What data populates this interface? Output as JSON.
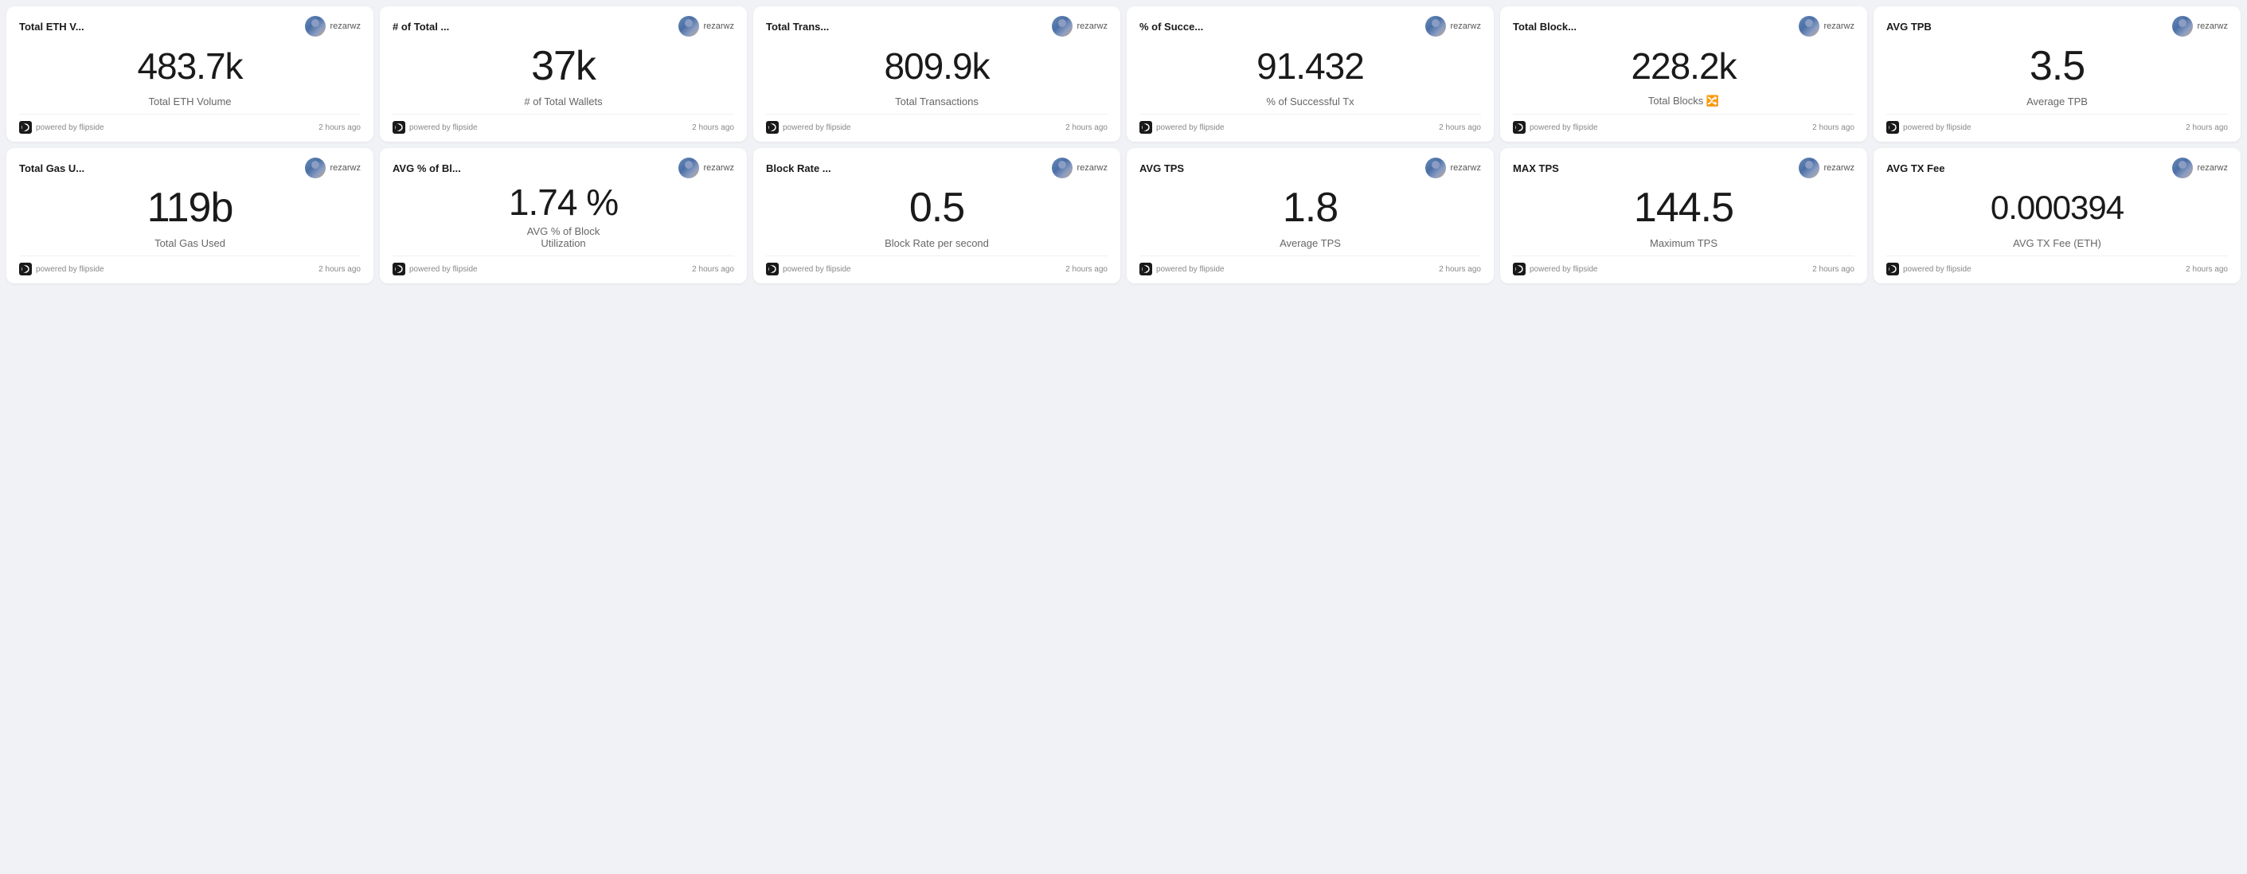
{
  "colors": {
    "accent": "#1a1a1a",
    "bg": "#f0f2f5",
    "card": "#ffffff"
  },
  "cards": [
    {
      "id": "card-1",
      "title": "Total ETH V...",
      "author": "rezarwz",
      "value": "483.7k",
      "label": "Total ETH Volume",
      "powered_by": "powered by flipside",
      "time_ago": "2 hours ago"
    },
    {
      "id": "card-2",
      "title": "# of Total ...",
      "author": "rezarwz",
      "value": "37k",
      "label": "# of Total Wallets",
      "powered_by": "powered by flipside",
      "time_ago": "2 hours ago"
    },
    {
      "id": "card-3",
      "title": "Total Trans...",
      "author": "rezarwz",
      "value": "809.9k",
      "label": "Total Transactions",
      "powered_by": "powered by flipside",
      "time_ago": "2 hours ago"
    },
    {
      "id": "card-4",
      "title": "% of Succe...",
      "author": "rezarwz",
      "value": "91.432",
      "label": "% of Successful Tx",
      "powered_by": "powered by flipside",
      "time_ago": "2 hours ago"
    },
    {
      "id": "card-5",
      "title": "Total Block...",
      "author": "rezarwz",
      "value": "228.2k",
      "label": "Total Blocks 🔀",
      "powered_by": "powered by flipside",
      "time_ago": "2 hours ago"
    },
    {
      "id": "card-6",
      "title": "AVG TPB",
      "author": "rezarwz",
      "value": "3.5",
      "label": "Average TPB",
      "powered_by": "powered by flipside",
      "time_ago": "2 hours ago"
    },
    {
      "id": "card-7",
      "title": "Total Gas U...",
      "author": "rezarwz",
      "value": "119b",
      "label": "Total Gas Used",
      "powered_by": "powered by flipside",
      "time_ago": "2 hours ago"
    },
    {
      "id": "card-8",
      "title": "AVG % of Bl...",
      "author": "rezarwz",
      "value": "1.74 %",
      "label": "AVG % of Block\nUtilization",
      "powered_by": "powered by flipside",
      "time_ago": "2 hours ago"
    },
    {
      "id": "card-9",
      "title": "Block Rate ...",
      "author": "rezarwz",
      "value": "0.5",
      "label": "Block Rate per second",
      "powered_by": "powered by flipside",
      "time_ago": "2 hours ago"
    },
    {
      "id": "card-10",
      "title": "AVG TPS",
      "author": "rezarwz",
      "value": "1.8",
      "label": "Average TPS",
      "powered_by": "powered by flipside",
      "time_ago": "2 hours ago"
    },
    {
      "id": "card-11",
      "title": "MAX TPS",
      "author": "rezarwz",
      "value": "144.5",
      "label": "Maximum TPS",
      "powered_by": "powered by flipside",
      "time_ago": "2 hours ago"
    },
    {
      "id": "card-12",
      "title": "AVG TX Fee",
      "author": "rezarwz",
      "value": "0.000394",
      "label": "AVG TX Fee (ETH)",
      "powered_by": "powered by flipside",
      "time_ago": "2 hours ago"
    }
  ]
}
